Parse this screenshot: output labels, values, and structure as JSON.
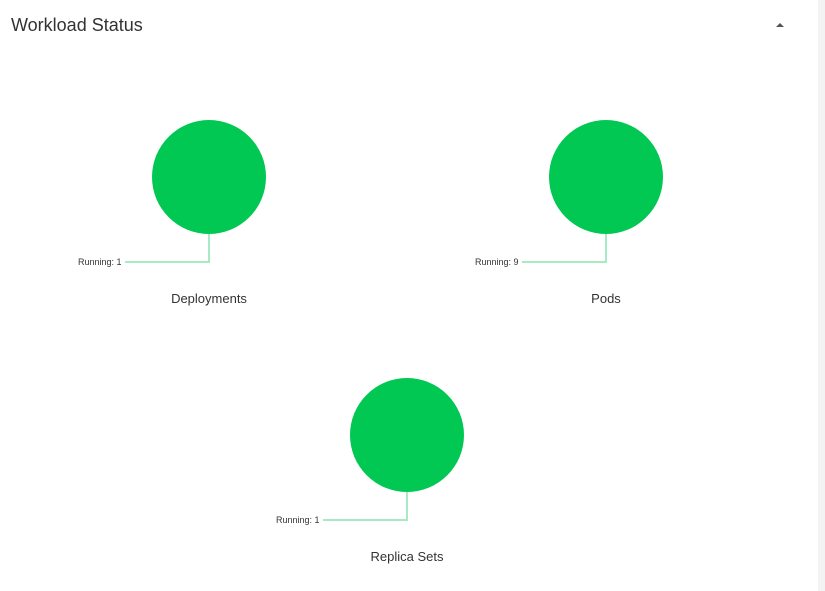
{
  "panel": {
    "title": "Workload Status"
  },
  "colors": {
    "running": "#00c853",
    "leader_line": "#a6ebc4"
  },
  "charts": [
    {
      "name": "Deployments",
      "status_label": "Running: 1",
      "running": 1
    },
    {
      "name": "Pods",
      "status_label": "Running: 9",
      "running": 9
    },
    {
      "name": "Replica Sets",
      "status_label": "Running: 1",
      "running": 1
    }
  ]
}
